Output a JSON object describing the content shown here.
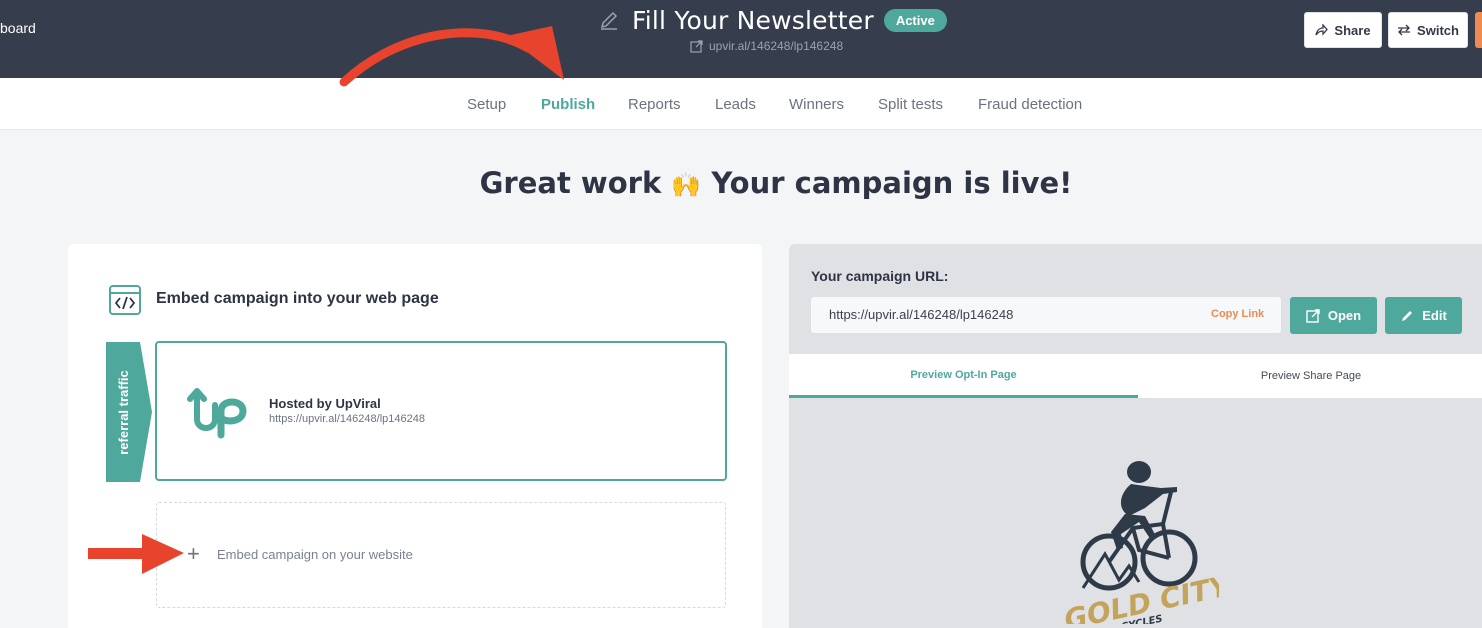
{
  "header": {
    "back_label": "board",
    "title": "Fill Your Newsletter",
    "status": "Active",
    "short_url": "upvir.al/146248/lp146248",
    "share_label": "Share",
    "switch_label": "Switch"
  },
  "nav": {
    "tabs": [
      {
        "label": "Setup"
      },
      {
        "label": "Publish",
        "active": true
      },
      {
        "label": "Reports"
      },
      {
        "label": "Leads"
      },
      {
        "label": "Winners"
      },
      {
        "label": "Split tests"
      },
      {
        "label": "Fraud detection"
      }
    ]
  },
  "hero": {
    "text_before": "Great work",
    "emoji": "🙌",
    "text_after": "Your campaign is live!"
  },
  "embed": {
    "title": "Embed campaign into your web page",
    "ribbon_label": "referral traffic",
    "hosted_title": "Hosted by UpViral",
    "hosted_url": "https://upvir.al/146248/lp146248",
    "add_label": "Embed campaign on your website"
  },
  "campaign_url": {
    "label": "Your campaign URL:",
    "value": "https://upvir.al/146248/lp146248",
    "copy_label": "Copy Link",
    "open_label": "Open",
    "edit_label": "Edit"
  },
  "preview": {
    "tabs": [
      "Preview Opt-In Page",
      "Preview Share Page"
    ],
    "logo_text": "GOLD CITY",
    "logo_sub": "CYCLES"
  },
  "colors": {
    "header_bg": "#363d4d",
    "accent": "#4fa89c",
    "orange": "#ee8a52",
    "annotation_red": "#e8432d"
  }
}
